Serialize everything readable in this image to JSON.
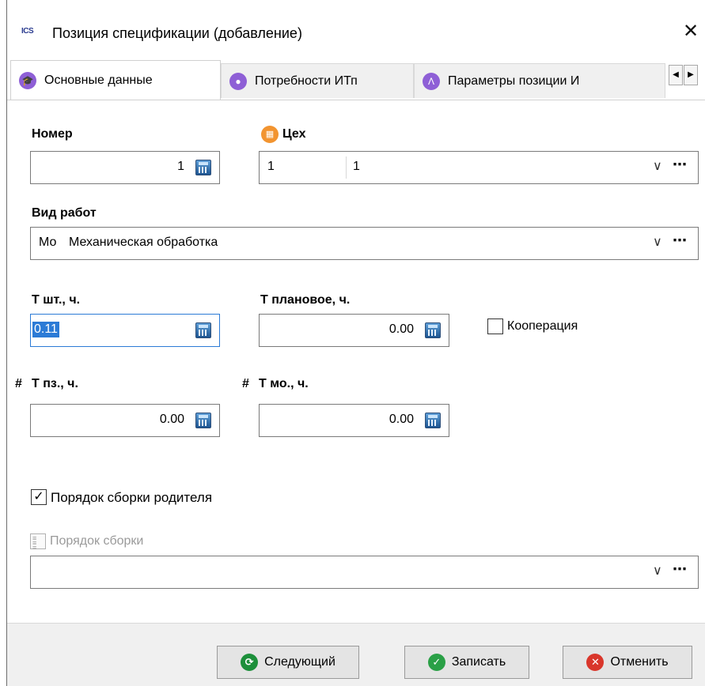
{
  "window": {
    "app_logo": "ICS",
    "title": "Позиция спецификации (добавление)",
    "close_glyph": "✕"
  },
  "tabs": [
    {
      "label": "Основные данные",
      "icon": "graduation-cap-icon",
      "color": "#8e5fd6",
      "active": true
    },
    {
      "label": "Потребности ИТп",
      "icon": "tag-icon",
      "color": "#8e5fd6",
      "active": false
    },
    {
      "label": "Параметры позиции И",
      "icon": "compass-icon",
      "color": "#8e5fd6",
      "active": false
    }
  ],
  "tab_scroll": {
    "left": "◀",
    "right": "▶"
  },
  "fields": {
    "nomer": {
      "label": "Номер",
      "value": "1"
    },
    "tseh": {
      "label": "Цех",
      "code": "1",
      "name": "1",
      "icon_color": "#f29430"
    },
    "vid_rabot": {
      "label": "Вид работ",
      "code": "Мо",
      "name": "Механическая обработка"
    },
    "t_sht": {
      "label": "Т шт., ч.",
      "value": "0.11"
    },
    "t_plan": {
      "label": "Т плановое, ч.",
      "value": "0.00"
    },
    "kooperaciya": {
      "label": "Кооперация",
      "checked": false
    },
    "t_pz": {
      "prefix": "#",
      "label": "Т пз., ч.",
      "value": "0.00"
    },
    "t_mo": {
      "prefix": "#",
      "label": "Т мо., ч.",
      "value": "0.00"
    },
    "poryadok_roditelya": {
      "label": "Порядок сборки родителя",
      "checked": true,
      "check_glyph": "✓"
    },
    "poryadok_sborki": {
      "label": "Порядок сборки",
      "value": ""
    }
  },
  "dropdown": {
    "arrow": "∨",
    "more": "⋯"
  },
  "buttons": {
    "next": {
      "label": "Следующий",
      "color": "#1c8f3a"
    },
    "save": {
      "label": "Записать",
      "color": "#2aa046"
    },
    "cancel": {
      "label": "Отменить",
      "color": "#d9362b"
    }
  }
}
